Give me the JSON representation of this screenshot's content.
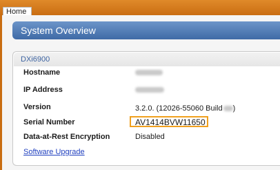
{
  "tabs": [
    {
      "label": "Home"
    }
  ],
  "panel": {
    "title": "System Overview"
  },
  "device": {
    "model": "DXi6900",
    "fields": {
      "hostname": {
        "label": "Hostname",
        "value": "harmony"
      },
      "ip_address": {
        "label": "IP Address",
        "value": "10.40.164.20"
      },
      "version": {
        "label": "Version",
        "value": "3.2.0. (12026-55060 Build",
        "suffix": ")"
      },
      "serial_number": {
        "label": "Serial Number",
        "value": "AV1414BVW11650"
      },
      "encryption": {
        "label": "Data-at-Rest Encryption",
        "value": "Disabled"
      }
    },
    "software_upgrade_label": "Software Upgrade"
  },
  "colors": {
    "tabstrip": "#c96d12",
    "header": "#4f7bb5",
    "highlight": "#f0a01e",
    "link": "#1f3fbf"
  }
}
